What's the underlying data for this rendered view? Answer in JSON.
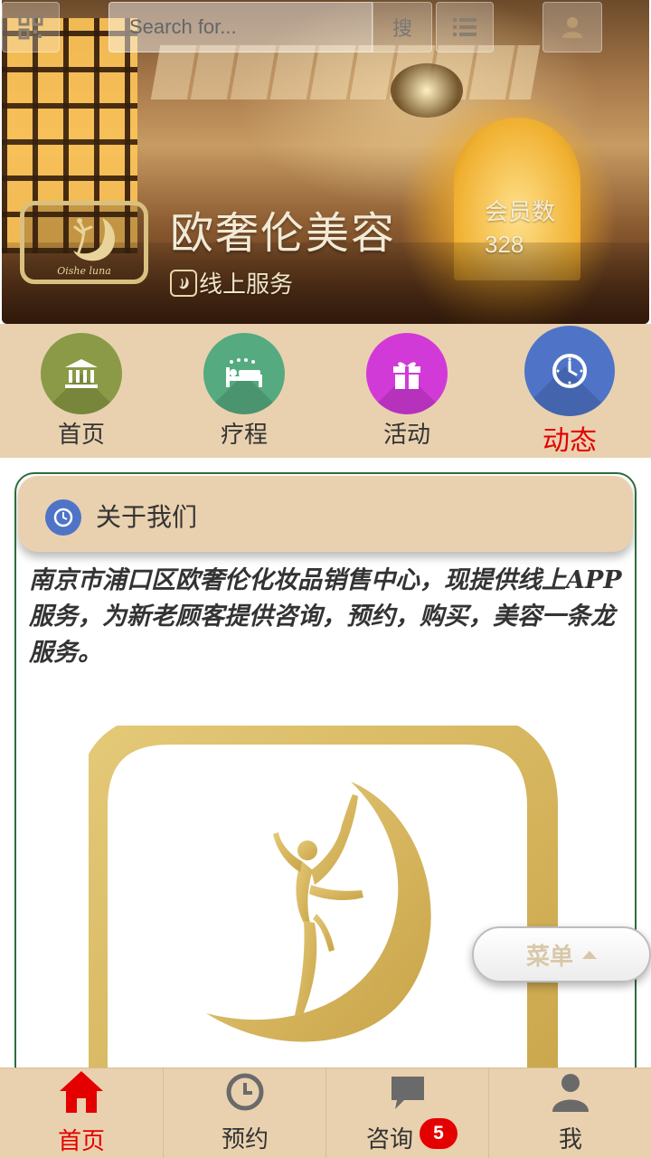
{
  "search": {
    "placeholder": "Search for...",
    "button_label": "搜"
  },
  "icons": {
    "qr": "qrcode-icon",
    "list": "list-icon",
    "user": "user-icon",
    "service": "dancer-logo-icon",
    "about": "clock-icon",
    "menu_caret": "caret-up-icon"
  },
  "brand": {
    "name": "欧奢伦美容",
    "logo_text": "Oishe luna",
    "service_label": "线上服务",
    "member_label": "会员数",
    "member_count": "328"
  },
  "nav": [
    {
      "label": "首页",
      "icon": "bank-icon",
      "color": "#8a9a46"
    },
    {
      "label": "疗程",
      "icon": "spa-bed-icon",
      "color": "#55aa80"
    },
    {
      "label": "活动",
      "icon": "gift-icon",
      "color": "#d23ad8"
    },
    {
      "label": "动态",
      "icon": "clock-icon",
      "color": "#4f74c7",
      "active": true
    }
  ],
  "about": {
    "title": "关于我们",
    "text": "南京市浦口区欧奢伦化妆品销售中心，现提供线上APP服务，为新老顾客提供咨询，预约，购买，美容一条龙服务。"
  },
  "float_menu": {
    "label": "菜单"
  },
  "tabs": [
    {
      "label": "首页",
      "icon": "home-icon",
      "active": true
    },
    {
      "label": "预约",
      "icon": "clock-icon"
    },
    {
      "label": "咨询",
      "icon": "chat-icon",
      "badge": "5"
    },
    {
      "label": "我",
      "icon": "user-icon"
    }
  ],
  "colors": {
    "accent_red": "#e40000",
    "beige": "#e9d1af",
    "gold": "#d4b060",
    "card_border": "#2d6d3a"
  }
}
